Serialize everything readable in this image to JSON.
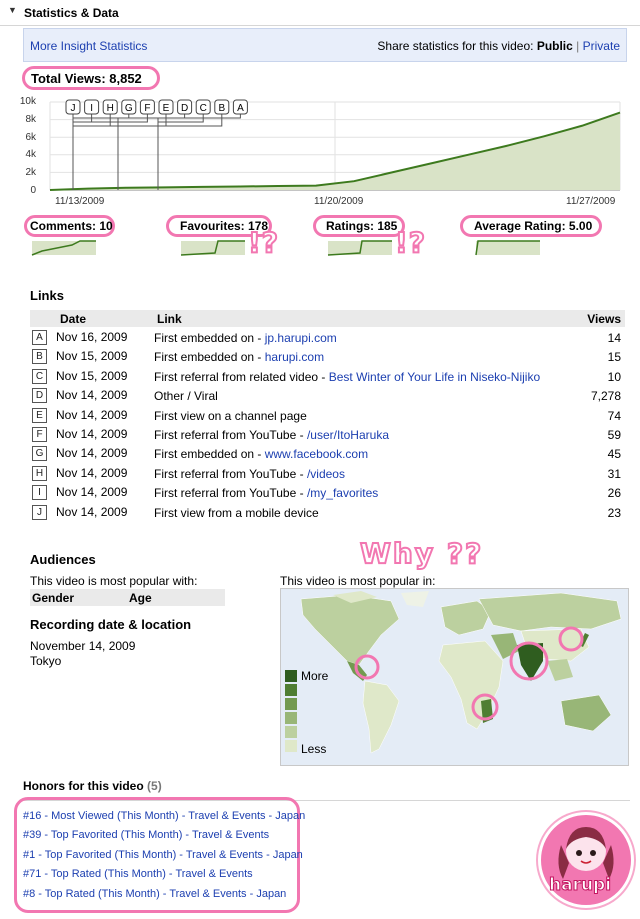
{
  "section": {
    "title": "Statistics & Data",
    "toggle_icon": "triangle-down-icon"
  },
  "insight": {
    "more_link": "More Insight Statistics",
    "share_label": "Share statistics for this video:",
    "public": "Public",
    "separator": "|",
    "private": "Private"
  },
  "total_views": "Total Views: 8,852",
  "chart_data": {
    "type": "area",
    "title": "Total Views: 8,852",
    "x_ticks": [
      "11/13/2009",
      "11/20/2009",
      "11/27/2009"
    ],
    "y_ticks": [
      "10k",
      "8k",
      "6k",
      "4k",
      "2k",
      "0"
    ],
    "ylim": [
      0,
      10000
    ],
    "x": [
      "11/13/2009",
      "11/14/2009",
      "11/15/2009",
      "11/16/2009",
      "11/17/2009",
      "11/18/2009",
      "11/19/2009",
      "11/20/2009",
      "11/21/2009",
      "11/22/2009",
      "11/23/2009",
      "11/24/2009",
      "11/25/2009",
      "11/26/2009",
      "11/27/2009",
      "11/28/2009"
    ],
    "values": [
      0,
      150,
      250,
      300,
      350,
      400,
      450,
      500,
      1000,
      2000,
      3000,
      4000,
      5000,
      6100,
      7300,
      8800
    ],
    "color": "#3d7a1e",
    "fill": "#d9e3c7",
    "markers": [
      "J",
      "I",
      "H",
      "G",
      "F",
      "E",
      "D",
      "C",
      "B",
      "A"
    ],
    "grid": true
  },
  "stats": [
    {
      "label": "Comments: 10"
    },
    {
      "label": "Favourites: 178"
    },
    {
      "label": "Ratings: 185"
    },
    {
      "label": "Average Rating: 5.00"
    }
  ],
  "exclamations": [
    "!?",
    "!?"
  ],
  "links": {
    "title": "Links",
    "headers": {
      "date": "Date",
      "link": "Link",
      "views": "Views"
    },
    "rows": [
      {
        "letter": "A",
        "date": "Nov 16, 2009",
        "text": "First embedded on - ",
        "link": "jp.harupi.com",
        "views": "14"
      },
      {
        "letter": "B",
        "date": "Nov 15, 2009",
        "text": "First embedded on - ",
        "link": "harupi.com",
        "views": "15"
      },
      {
        "letter": "C",
        "date": "Nov 15, 2009",
        "text": "First referral from related video - ",
        "link": "Best Winter of Your Life in Niseko-Nijiko",
        "views": "10"
      },
      {
        "letter": "D",
        "date": "Nov 14, 2009",
        "text": "Other / Viral",
        "link": "",
        "views": "7,278"
      },
      {
        "letter": "E",
        "date": "Nov 14, 2009",
        "text": "First view on a channel page",
        "link": "",
        "views": "74"
      },
      {
        "letter": "F",
        "date": "Nov 14, 2009",
        "text": "First referral from YouTube - ",
        "link": "/user/ItoHaruka",
        "views": "59"
      },
      {
        "letter": "G",
        "date": "Nov 14, 2009",
        "text": "First embedded on - ",
        "link": "www.facebook.com",
        "views": "45"
      },
      {
        "letter": "H",
        "date": "Nov 14, 2009",
        "text": "First referral from YouTube - ",
        "link": "/videos",
        "views": "31"
      },
      {
        "letter": "I",
        "date": "Nov 14, 2009",
        "text": "First referral from YouTube - ",
        "link": "/my_favorites",
        "views": "26"
      },
      {
        "letter": "J",
        "date": "Nov 14, 2009",
        "text": "First view from a mobile device",
        "link": "",
        "views": "23"
      }
    ]
  },
  "audiences": {
    "title": "Audiences",
    "subtitle": "This video is most popular with:",
    "col_gender": "Gender",
    "col_age": "Age"
  },
  "recording": {
    "title": "Recording date & location",
    "date": "November 14, 2009",
    "location": "Tokyo"
  },
  "map": {
    "caption": "This video is most popular in:",
    "legend_more": "More",
    "legend_less": "Less",
    "legend_colors": [
      "#2f5d1f",
      "#4f7e32",
      "#739a50",
      "#98b677",
      "#bcd09f",
      "#dfe8c9"
    ]
  },
  "why_text": "Why ??",
  "honors": {
    "title": "Honors for this video",
    "count": "(5)",
    "items": [
      "#16 - Most Viewed (This Month) - Travel & Events - Japan",
      "#39 - Top Favorited (This Month) - Travel & Events",
      "#1 - Top Favorited (This Month) - Travel & Events - Japan",
      "#71 - Top Rated (This Month) - Travel & Events",
      "#8 - Top Rated (This Month) - Travel & Events - Japan"
    ]
  },
  "logo": {
    "text": "harupi"
  },
  "colors": {
    "accent_pink": "#f277b1",
    "link_blue": "#1c3fb0",
    "chart_green": "#3d7a1e"
  }
}
